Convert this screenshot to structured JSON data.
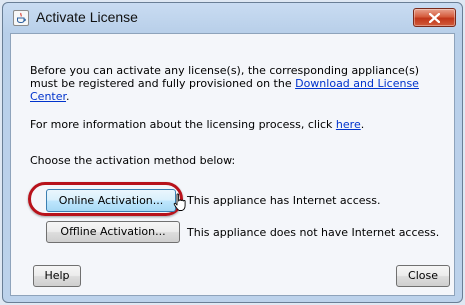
{
  "window": {
    "title": "Activate License",
    "close_icon": "close-icon",
    "app_icon": "java-cup-icon"
  },
  "body": {
    "para1_before_link": "Before you can activate any license(s), the corresponding appliance(s) must be registered and fully provisioned on the ",
    "para1_link": "Download and License Center",
    "para1_after_link": ".",
    "para2_before_link": "For more information about the licensing process, click ",
    "para2_link": "here",
    "para2_after_link": ".",
    "para3": "Choose the activation method below:"
  },
  "options": [
    {
      "label": "Online Activation...",
      "description": "This appliance has Internet access."
    },
    {
      "label": "Offline Activation...",
      "description": "This appliance does not have Internet access."
    }
  ],
  "footer": {
    "help_label": "Help",
    "close_label": "Close"
  },
  "colors": {
    "highlight_ring": "#b8121b",
    "link": "#0033cc",
    "close_button": "#c1361a"
  }
}
